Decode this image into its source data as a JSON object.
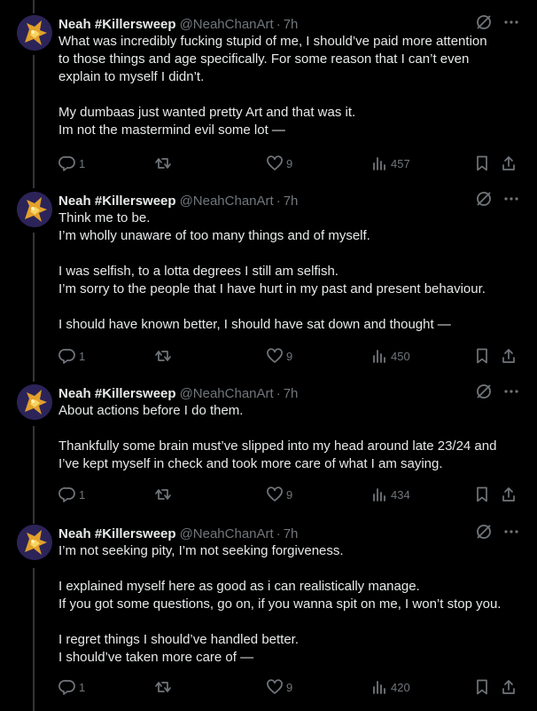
{
  "tweets": [
    {
      "display_name": "Neah #Killersweep",
      "handle": "@NeahChanArt",
      "separator": "·",
      "time": "7h",
      "paragraphs": [
        "What was incredibly fucking stupid of me, I should’ve paid more attention\nto those things and age specifically. For some reason that I can’t even\nexplain to myself I didn’t.",
        "My dumbaas just wanted pretty Art and that was it.\nIm not the mastermind evil some lot —"
      ],
      "replies": "1",
      "retweets": "",
      "likes": "9",
      "views": "457"
    },
    {
      "display_name": "Neah #Killersweep",
      "handle": "@NeahChanArt",
      "separator": "·",
      "time": "7h",
      "paragraphs": [
        "Think me to be.\nI’m wholly unaware of too many things and of myself.",
        "I was selfish, to a lotta degrees I still am selfish.\nI’m sorry to the people that I have hurt in my past and present behaviour.",
        "I should have known better, I should have sat down and thought —"
      ],
      "replies": "1",
      "retweets": "",
      "likes": "9",
      "views": "450"
    },
    {
      "display_name": "Neah #Killersweep",
      "handle": "@NeahChanArt",
      "separator": "·",
      "time": "7h",
      "paragraphs": [
        "About actions before I do them.",
        "Thankfully some brain must’ve slipped into my head around late 23/24 and\nI’ve kept myself in check and took more care of what I am saying."
      ],
      "replies": "1",
      "retweets": "",
      "likes": "9",
      "views": "434"
    },
    {
      "display_name": "Neah #Killersweep",
      "handle": "@NeahChanArt",
      "separator": "·",
      "time": "7h",
      "paragraphs": [
        "I’m not seeking pity, I’m not seeking forgiveness.",
        "I explained myself here as good as i can realistically manage.\nIf you got some questions, go on, if you wanna spit on me, I won’t stop you.",
        "I regret things I should’ve handled better.\nI should’ve taken more care of —"
      ],
      "replies": "1",
      "retweets": "",
      "likes": "9",
      "views": "420"
    }
  ],
  "icons": {
    "avatar": "avatar-image",
    "grok": "slashed-circle-icon",
    "more": "more-dots-icon",
    "reply": "reply-icon",
    "retweet": "retweet-icon",
    "like": "heart-icon",
    "views": "views-bar-chart-icon",
    "bookmark": "bookmark-icon",
    "share": "share-icon"
  },
  "colors": {
    "background": "#000000",
    "text": "#e7e9ea",
    "secondary": "#71767b",
    "thread_line": "#333639"
  }
}
